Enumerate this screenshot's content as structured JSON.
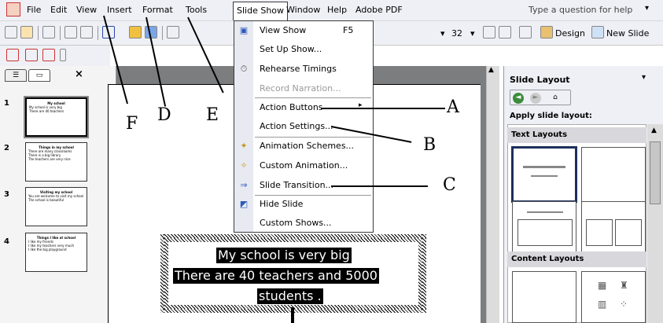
{
  "menubar": {
    "items": [
      "File",
      "Edit",
      "View",
      "Insert",
      "Format",
      "Tools",
      "Slide Show",
      "Window",
      "Help",
      "Adobe PDF"
    ],
    "help_placeholder": "Type a question for help"
  },
  "toolbar": {
    "font_size": "32",
    "design_label": "Design",
    "new_slide_label": "New Slide"
  },
  "left_pane": {
    "slides": [
      {
        "num": "1",
        "title": "My school",
        "lines": [
          "My school is very big",
          "There are 40 teachers"
        ]
      },
      {
        "num": "2",
        "title": "Things in my school",
        "lines": [
          "There are many classrooms",
          "There is a big library",
          "The teachers are very nice"
        ]
      },
      {
        "num": "3",
        "title": "Visiting my school",
        "lines": [
          "You are welcome to visit my school",
          "The school is beautiful"
        ]
      },
      {
        "num": "4",
        "title": "Things I like at school",
        "lines": [
          "I like my friends",
          "I like my teachers very much",
          "I like the big playground"
        ]
      }
    ]
  },
  "slide": {
    "lines": [
      "My school is very big",
      "There are 40 teachers  and  5000",
      "students ."
    ]
  },
  "menu": {
    "view_show": "View Show",
    "view_show_shortcut": "F5",
    "setup_show": "Set Up Show...",
    "rehearse": "Rehearse Timings",
    "record_narration": "Record Narration...",
    "action_buttons": "Action Buttons",
    "action_settings": "Action Settings...",
    "animation_schemes": "Animation Schemes...",
    "custom_animation": "Custom Animation...",
    "slide_transition": "Slide Transition...",
    "hide_slide": "Hide Slide",
    "custom_shows": "Custom Shows..."
  },
  "task_pane": {
    "title": "Slide Layout",
    "apply_label": "Apply slide layout:",
    "text_layouts": "Text Layouts",
    "content_layouts": "Content Layouts"
  },
  "annotations": [
    "A",
    "B",
    "C",
    "D",
    "E",
    "F"
  ]
}
